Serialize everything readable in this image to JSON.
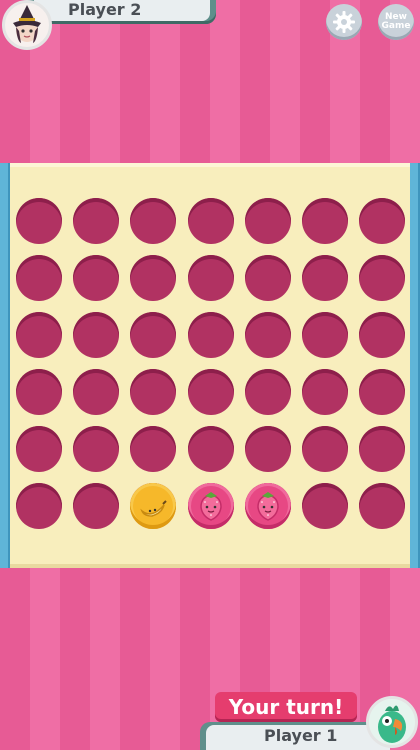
{
  "top": {
    "player_name": "Player 2",
    "avatar_icon": "witch-avatar-icon",
    "settings_icon": "gear-icon",
    "new_game_label_line1": "New",
    "new_game_label_line2": "Game"
  },
  "board": {
    "columns": 7,
    "rows": 6,
    "pieces": [
      {
        "row": 6,
        "col": 3,
        "type": "banana"
      },
      {
        "row": 6,
        "col": 4,
        "type": "strawberry"
      },
      {
        "row": 6,
        "col": 5,
        "type": "strawberry"
      }
    ]
  },
  "bottom": {
    "turn_text": "Your turn!",
    "player_name": "Player 1",
    "avatar_icon": "parrot-avatar-icon"
  },
  "colors": {
    "background_pink": "#e75b95",
    "board_cream": "#f8eebd",
    "hole": "#b13262",
    "banana_disc": "#f6b82a",
    "strawberry_disc": "#e74884",
    "turn_banner": "#e53d6e"
  }
}
